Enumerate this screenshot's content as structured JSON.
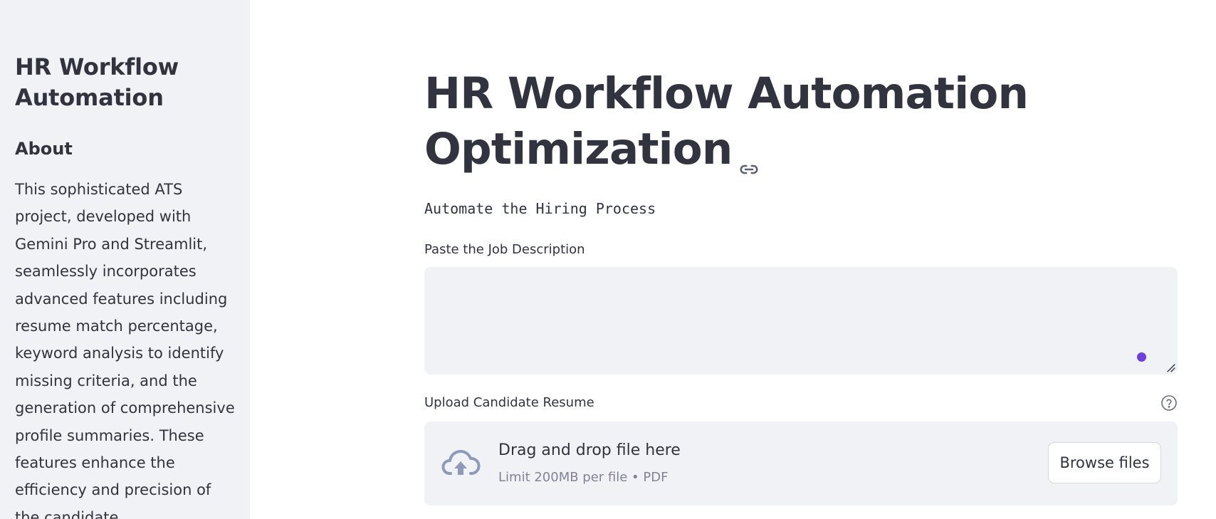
{
  "sidebar": {
    "title": "HR Workflow Automation",
    "about_heading": "About",
    "about_text": "This sophisticated ATS project, developed with Gemini Pro and Streamlit, seamlessly incorporates advanced features including resume match percentage, keyword analysis to identify missing criteria, and the generation of comprehensive profile summaries. These features enhance the efficiency and precision of the candidate"
  },
  "main": {
    "title": "HR Workflow Automation Optimization",
    "subtitle": "Automate the Hiring Process",
    "job_description": {
      "label": "Paste the Job Description",
      "value": ""
    },
    "resume_upload": {
      "label": "Upload Candidate Resume",
      "drop_text": "Drag and drop file here",
      "limit_text": "Limit 200MB per file • PDF",
      "browse_label": "Browse files"
    }
  },
  "colors": {
    "sidebar_bg": "#f0f2f6",
    "text": "#31333f",
    "muted_text": "#808495",
    "accent": "#6c3ee3",
    "icon": "#8e9ab8"
  },
  "icons": [
    "link-icon",
    "help-icon",
    "cloud-upload-icon",
    "resize-grip-icon"
  ]
}
